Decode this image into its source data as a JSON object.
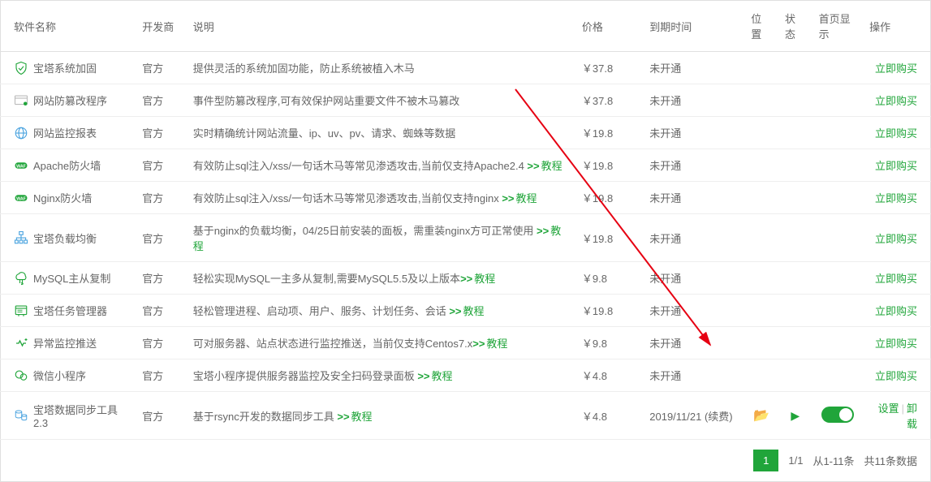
{
  "headers": {
    "name": "软件名称",
    "dev": "开发商",
    "desc": "说明",
    "price": "价格",
    "expire": "到期时间",
    "pos": "位置",
    "status": "状态",
    "home": "首页显示",
    "action": "操作"
  },
  "rows": [
    {
      "name": "宝塔系统加固",
      "dev": "官方",
      "desc": "提供灵活的系统加固功能，防止系统被植入木马",
      "tutorial": "",
      "price": "￥37.8",
      "expire": "未开通",
      "action": "立即购买",
      "type": "buy",
      "icon": "shield"
    },
    {
      "name": "网站防篡改程序",
      "dev": "官方",
      "desc": "事件型防篡改程序,可有效保护网站重要文件不被木马篡改",
      "tutorial": "",
      "price": "￥37.8",
      "expire": "未开通",
      "action": "立即购买",
      "type": "buy",
      "icon": "window"
    },
    {
      "name": "网站监控报表",
      "dev": "官方",
      "desc": "实时精确统计网站流量、ip、uv、pv、请求、蜘蛛等数据",
      "tutorial": "",
      "price": "￥19.8",
      "expire": "未开通",
      "action": "立即购买",
      "type": "buy",
      "icon": "globe"
    },
    {
      "name": "Apache防火墙",
      "dev": "官方",
      "desc": "有效防止sql注入/xss/一句话木马等常见渗透攻击,当前仅支持Apache2.4 ",
      "tutorial": "教程",
      "price": "￥19.8",
      "expire": "未开通",
      "action": "立即购买",
      "type": "buy",
      "icon": "waf"
    },
    {
      "name": "Nginx防火墙",
      "dev": "官方",
      "desc": "有效防止sql注入/xss/一句话木马等常见渗透攻击,当前仅支持nginx ",
      "tutorial": "教程",
      "price": "￥19.8",
      "expire": "未开通",
      "action": "立即购买",
      "type": "buy",
      "icon": "waf"
    },
    {
      "name": "宝塔负载均衡",
      "dev": "官方",
      "desc": "基于nginx的负载均衡，04/25日前安装的面板，需重装nginx方可正常使用 ",
      "tutorial": "教程",
      "price": "￥19.8",
      "expire": "未开通",
      "action": "立即购买",
      "type": "buy",
      "icon": "balance"
    },
    {
      "name": "MySQL主从复制",
      "dev": "官方",
      "desc": "轻松实现MySQL一主多从复制,需要MySQL5.5及以上版本",
      "tutorial": "教程",
      "price": "￥9.8",
      "expire": "未开通",
      "action": "立即购买",
      "type": "buy",
      "icon": "clouddb"
    },
    {
      "name": "宝塔任务管理器",
      "dev": "官方",
      "desc": "轻松管理进程、启动项、用户、服务、计划任务、会话 ",
      "tutorial": "教程",
      "price": "￥19.8",
      "expire": "未开通",
      "action": "立即购买",
      "type": "buy",
      "icon": "task"
    },
    {
      "name": "异常监控推送",
      "dev": "官方",
      "desc": "可对服务器、站点状态进行监控推送，当前仅支持Centos7.x",
      "tutorial": "教程",
      "price": "￥9.8",
      "expire": "未开通",
      "action": "立即购买",
      "type": "buy",
      "icon": "bell"
    },
    {
      "name": "微信小程序",
      "dev": "官方",
      "desc": "宝塔小程序提供服务器监控及安全扫码登录面板 ",
      "tutorial": "教程",
      "price": "￥4.8",
      "expire": "未开通",
      "action": "立即购买",
      "type": "buy",
      "icon": "wechat"
    },
    {
      "name": "宝塔数据同步工具 2.3",
      "dev": "官方",
      "desc": "基于rsync开发的数据同步工具 ",
      "tutorial": "教程",
      "price": "￥4.8",
      "expire": "2019/11/21 (续费)",
      "action": "设置",
      "action2": "卸载",
      "type": "installed",
      "icon": "dbsync"
    }
  ],
  "tutorial_label": "教程",
  "footer": {
    "page": "1",
    "pages": "1/1",
    "range": "从1-11条",
    "total": "共11条数据"
  }
}
